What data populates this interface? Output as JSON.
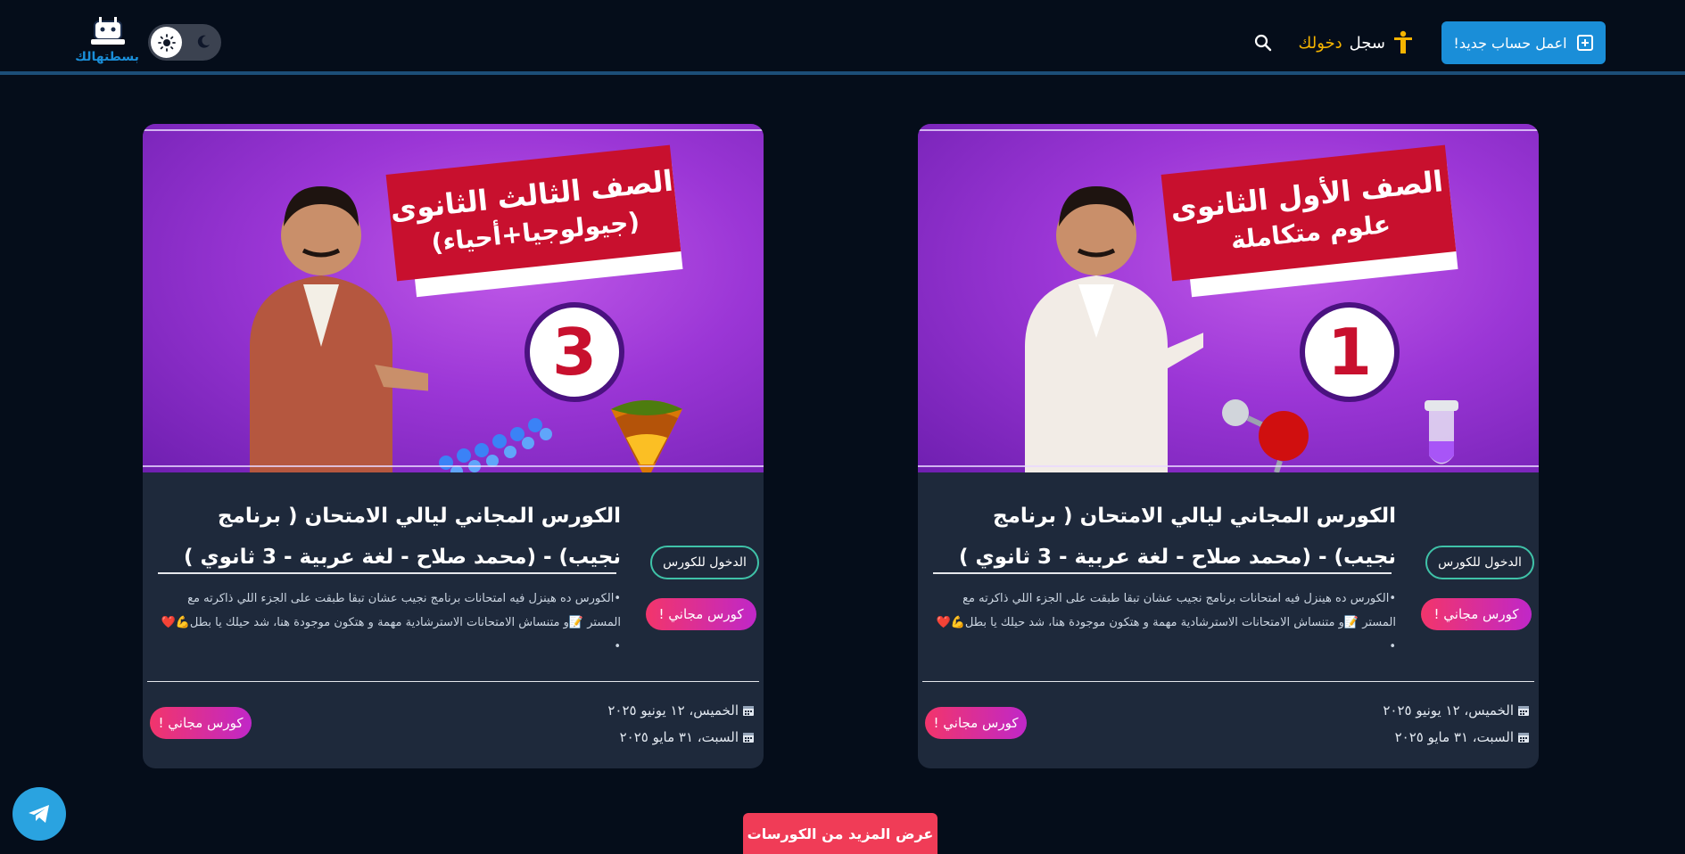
{
  "header": {
    "logo_text": "بسطتهالك",
    "signup_label": "اعمل حساب جديد!",
    "login_label": "سجل",
    "login_label_accent": "دخولك",
    "theme_toggle_icons": [
      "sun-icon",
      "moon-icon"
    ],
    "search_icon": "search-icon"
  },
  "colors": {
    "background": "#050d1a",
    "card_bg": "#1e293b",
    "primary_blue": "#1a8ed8",
    "accent_yellow": "#f5b400",
    "teal_outline": "#3fc2a8",
    "badge_gradient": [
      "#f2356b",
      "#c027c8"
    ],
    "more_button": "#f03c57",
    "telegram": "#2aa3e0"
  },
  "courses": [
    {
      "banner_line1": "الصف الأول الثانوى",
      "banner_line2": "علوم متكاملة",
      "grade_number": "1",
      "title": "الكورس المجاني ليالي الامتحان ( برنامج نجيب) - (محمد صلاح - لغة عربية - 3 ثانوي )",
      "description": "•الكورس ده هينزل فيه امتحانات برنامج نجيب عشان تبقا طبقت على الجزء اللي ذاكرته مع المستر 📝و متنساش الامتحانات الاسترشادية مهمة و هتكون موجودة هنا، شد حيلك يا بطل💪❤️ •",
      "enter_label": "الدخول للكورس",
      "free_label": "كورس مجاني !",
      "date_1": "الخميس، ١٢ يونيو ٢٠٢٥",
      "date_2": "السبت، ٣١ مايو ٢٠٢٥"
    },
    {
      "banner_line1": "الصف الثالث الثانوى",
      "banner_line2": "(جيولوجيا+أحياء)",
      "grade_number": "3",
      "title": "الكورس المجاني ليالي الامتحان ( برنامج نجيب) - (محمد صلاح - لغة عربية - 3 ثانوي )",
      "description": "•الكورس ده هينزل فيه امتحانات برنامج نجيب عشان تبقا طبقت على الجزء اللي ذاكرته مع المستر 📝و متنساش الامتحانات الاسترشادية مهمة و هتكون موجودة هنا، شد حيلك يا بطل💪❤️ •",
      "enter_label": "الدخول للكورس",
      "free_label": "كورس مجاني !",
      "date_1": "الخميس، ١٢ يونيو ٢٠٢٥",
      "date_2": "السبت، ٣١ مايو ٢٠٢٥"
    }
  ],
  "more_courses_label": "عرض المزيد من الكورسات",
  "telegram_icon": "telegram-icon"
}
